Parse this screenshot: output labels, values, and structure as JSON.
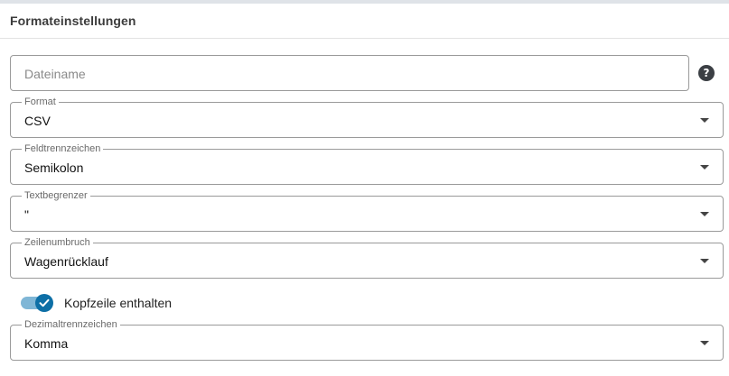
{
  "panel": {
    "title": "Formateinstellungen"
  },
  "filename": {
    "placeholder": "Dateiname",
    "help_glyph": "?"
  },
  "fields": [
    {
      "label": "Format",
      "value": "CSV"
    },
    {
      "label": "Feldtrennzeichen",
      "value": "Semikolon"
    },
    {
      "label": "Textbegrenzer",
      "value": "\""
    },
    {
      "label": "Zeilenumbruch",
      "value": "Wagenrücklauf"
    },
    {
      "label": "Dezimaltrennzeichen",
      "value": "Komma"
    }
  ],
  "header_toggle": {
    "label": "Kopfzeile enthalten",
    "checked": true
  },
  "colors": {
    "accent": "#0d6fa6",
    "accent_track": "#7fb6d6",
    "border": "#9a9a9a"
  },
  "icons": {
    "help": "help-circle-icon",
    "dropdown": "caret-down-icon",
    "check": "check-icon"
  }
}
